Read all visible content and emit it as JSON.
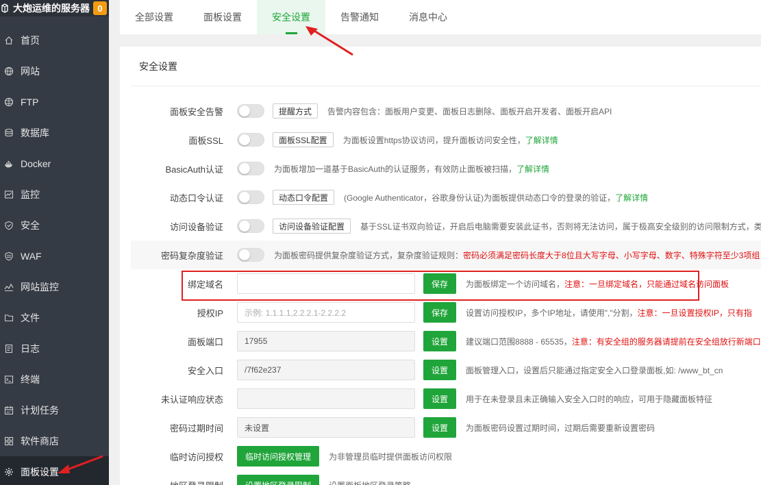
{
  "sidebar": {
    "title": "大炮运维的服务器",
    "badge": "0",
    "items": [
      {
        "label": "首页",
        "icon": "home-icon"
      },
      {
        "label": "网站",
        "icon": "globe-icon"
      },
      {
        "label": "FTP",
        "icon": "ftp-globe-icon"
      },
      {
        "label": "数据库",
        "icon": "database-icon"
      },
      {
        "label": "Docker",
        "icon": "docker-icon"
      },
      {
        "label": "监控",
        "icon": "monitor-chart-icon"
      },
      {
        "label": "安全",
        "icon": "shield-icon"
      },
      {
        "label": "WAF",
        "icon": "waf-shield-icon"
      },
      {
        "label": "网站监控",
        "icon": "site-monitor-icon"
      },
      {
        "label": "文件",
        "icon": "folder-icon"
      },
      {
        "label": "日志",
        "icon": "log-icon"
      },
      {
        "label": "终端",
        "icon": "terminal-icon"
      },
      {
        "label": "计划任务",
        "icon": "calendar-icon"
      },
      {
        "label": "软件商店",
        "icon": "grid-apps-icon"
      },
      {
        "label": "面板设置",
        "icon": "gear-icon"
      }
    ]
  },
  "tabs": [
    {
      "label": "全部设置"
    },
    {
      "label": "面板设置"
    },
    {
      "label": "安全设置"
    },
    {
      "label": "告警通知"
    },
    {
      "label": "消息中心"
    }
  ],
  "panel": {
    "title": "安全设置"
  },
  "rows": {
    "alert": {
      "label": "面板安全告警",
      "button": "提醒方式",
      "desc": "告警内容包含：面板用户变更、面板日志删除、面板开启开发者、面板开启API"
    },
    "ssl": {
      "label": "面板SSL",
      "button": "面板SSL配置",
      "desc": "为面板设置https协议访问，提升面板访问安全性，",
      "link": "了解详情"
    },
    "basicauth": {
      "label": "BasicAuth认证",
      "desc": "为面板增加一道基于BasicAuth的认证服务，有效防止面板被扫描，",
      "link": "了解详情"
    },
    "otp": {
      "label": "动态口令认证",
      "button": "动态口令配置",
      "desc": "(Google Authenticator，谷歌身份认证)为面板提供动态口令的登录的验证，",
      "link": "了解详情"
    },
    "device": {
      "label": "访问设备验证",
      "button": "访问设备验证配置",
      "desc": "基于SSL证书双向验证，开启后电脑需要安装此证书，否则将无法访问，属于极高安全级别的访问限制方式，类"
    },
    "pwdcomplex": {
      "label": "密码复杂度验证",
      "desc": "为面板密码提供复杂度验证方式，复杂度验证规则：",
      "warn": "密码必须满足密码长度大于8位且大写字母、小写字母、数字、特殊字符至少3项组"
    },
    "domain": {
      "label": "绑定域名",
      "value": "",
      "button": "保存",
      "desc": "为面板绑定一个访问域名，",
      "warn": "注意：一旦绑定域名，只能通过域名访问面板"
    },
    "ip": {
      "label": "授权IP",
      "placeholder": "示例: 1.1.1.1,2.2.2.1-2.2.2.2",
      "button": "保存",
      "desc": "设置访问授权IP，多个IP地址，请使用\",\"分割，",
      "warn": "注意：一旦设置授权IP，只有指"
    },
    "port": {
      "label": "面板端口",
      "value": "17955",
      "button": "设置",
      "desc": "建议端口范围8888 - 65535，",
      "warn": "注意：有安全组的服务器请提前在安全组放行新端口"
    },
    "entry": {
      "label": "安全入口",
      "value": "/7f62e237",
      "button": "设置",
      "desc": "面板管理入口，设置后只能通过指定安全入口登录面板,如: /www_bt_cn"
    },
    "unauth": {
      "label": "未认证响应状态",
      "value": "",
      "button": "设置",
      "desc": "用于在未登录且未正确输入安全入口时的响应，可用于隐藏面板特征"
    },
    "pwdexpire": {
      "label": "密码过期时间",
      "value": "未设置",
      "button": "设置",
      "desc": "为面板密码设置过期时间，过期后需要重新设置密码"
    },
    "tempauth": {
      "label": "临时访问授权",
      "button": "临时访问授权管理",
      "desc": "为非管理员临时提供面板访问权限"
    },
    "region": {
      "label": "地区登录限制",
      "button": "设置地区登录限制",
      "desc": "设置面板地区登录策略"
    }
  },
  "colors": {
    "accent": "#20a53a",
    "warn": "#e01010",
    "sidebar": "#353b45"
  }
}
